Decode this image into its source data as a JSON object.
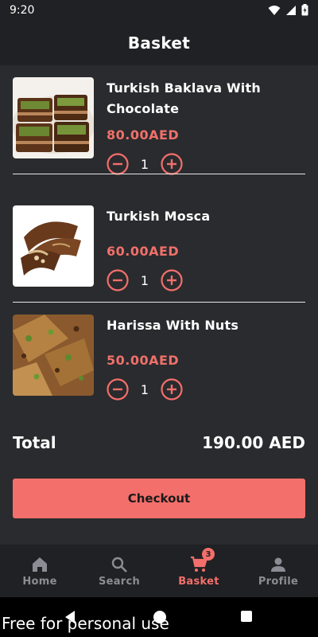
{
  "status_bar": {
    "time": "9:20"
  },
  "header": {
    "title": "Basket"
  },
  "items": [
    {
      "name": "Turkish Baklava With Chocolate",
      "price": "80.00AED",
      "quantity": "1"
    },
    {
      "name": "Turkish Mosca",
      "price": "60.00AED",
      "quantity": "1"
    },
    {
      "name": "Harissa With Nuts",
      "price": "50.00AED",
      "quantity": "1"
    }
  ],
  "total": {
    "label": "Total",
    "value": "190.00 AED"
  },
  "checkout": {
    "label": "Checkout"
  },
  "bottom_nav": {
    "items": [
      {
        "label": "Home",
        "icon": "home-icon"
      },
      {
        "label": "Search",
        "icon": "search-icon"
      },
      {
        "label": "Basket",
        "icon": "cart-icon",
        "badge": "3",
        "active": true
      },
      {
        "label": "Profile",
        "icon": "person-icon"
      }
    ]
  },
  "watermark": "Free for personal use",
  "colors": {
    "accent": "#f36f6b",
    "price": "#f0706a",
    "background": "#2a2b2e",
    "bar": "#202124",
    "nav_inactive": "#8a8d93"
  }
}
